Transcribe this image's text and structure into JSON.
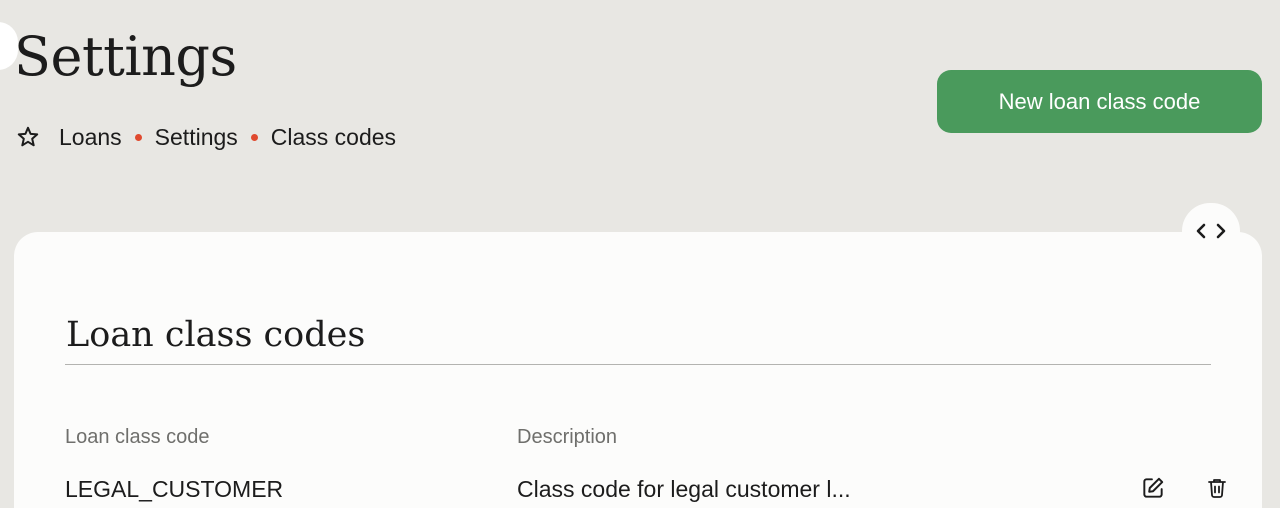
{
  "page": {
    "title": "Settings"
  },
  "breadcrumb": {
    "icon": "star-icon",
    "items": [
      "Loans",
      "Settings",
      "Class codes"
    ],
    "separator_color": "#e04a2f"
  },
  "actions": {
    "new_button_label": "New loan class code",
    "accent_color": "#4a9a5c"
  },
  "scroll_toggle": {
    "prev_icon": "chevron-left-icon",
    "next_icon": "chevron-right-icon"
  },
  "section": {
    "title": "Loan class codes"
  },
  "table": {
    "columns": [
      "Loan class code",
      "Description"
    ],
    "rows": [
      {
        "code": "LEGAL_CUSTOMER",
        "description": "Class code for legal customer l...",
        "actions": [
          "edit-icon",
          "trash-icon"
        ]
      }
    ]
  }
}
